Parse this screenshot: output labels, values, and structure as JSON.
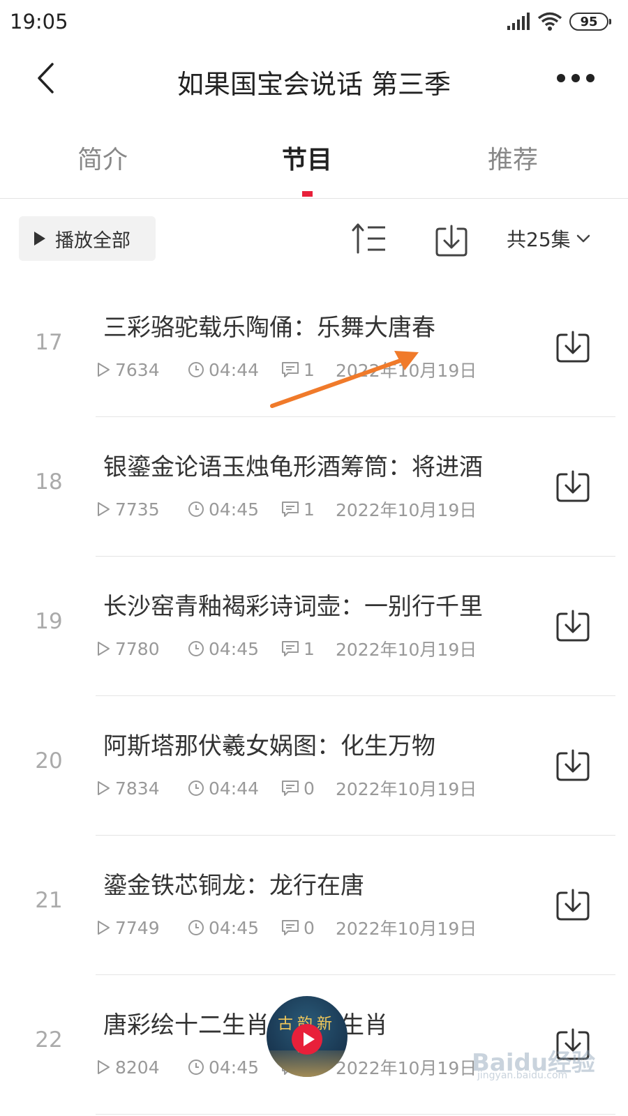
{
  "status_bar": {
    "time": "19:05",
    "battery": "95"
  },
  "header": {
    "title": "如果国宝会说话 第三季"
  },
  "tabs": [
    {
      "label": "简介",
      "active": false
    },
    {
      "label": "节目",
      "active": true
    },
    {
      "label": "推荐",
      "active": false
    }
  ],
  "toolbar": {
    "play_all_label": "播放全部",
    "episode_count": "共25集"
  },
  "episodes": [
    {
      "num": "17",
      "title": "三彩骆驼载乐陶俑：乐舞大唐春",
      "plays": "7634",
      "duration": "04:44",
      "comments": "1",
      "date": "2022年10月19日"
    },
    {
      "num": "18",
      "title": "银鎏金论语玉烛龟形酒筹筒：将进酒",
      "plays": "7735",
      "duration": "04:45",
      "comments": "1",
      "date": "2022年10月19日"
    },
    {
      "num": "19",
      "title": "长沙窑青釉褐彩诗词壶：一别行千里",
      "plays": "7780",
      "duration": "04:45",
      "comments": "1",
      "date": "2022年10月19日"
    },
    {
      "num": "20",
      "title": "阿斯塔那伏羲女娲图：化生万物",
      "plays": "7834",
      "duration": "04:44",
      "comments": "0",
      "date": "2022年10月19日"
    },
    {
      "num": "21",
      "title": "鎏金铁芯铜龙：龙行在唐",
      "plays": "7749",
      "duration": "04:45",
      "comments": "0",
      "date": "2022年10月19日"
    },
    {
      "num": "22",
      "title": "唐彩绘十二生肖：十二生肖",
      "plays": "8204",
      "duration": "04:45",
      "comments": "0",
      "date": "2022年10月19日"
    }
  ],
  "floating_player": {
    "label": "古韵新声"
  },
  "watermark": {
    "text": "Baidu经验",
    "sub": "jingyan.baidu.com"
  },
  "colors": {
    "accent": "#e8203a",
    "annotation_arrow": "#f07a2a"
  }
}
